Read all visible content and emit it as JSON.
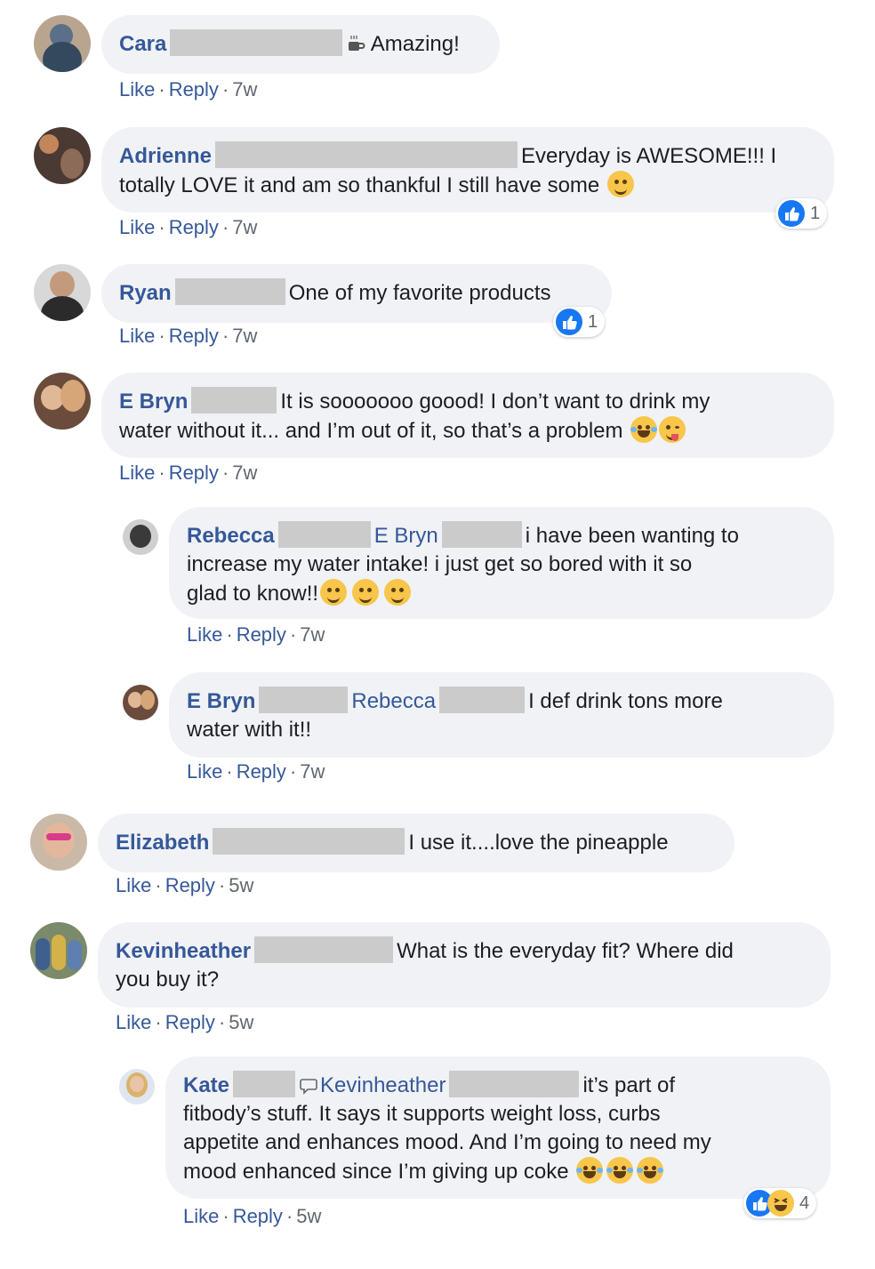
{
  "meta_labels": {
    "like": "Like",
    "reply": "Reply",
    "sep": "·"
  },
  "comments": [
    {
      "name": "Cara",
      "text": "Amazing!",
      "time": "7w"
    },
    {
      "name": "Adrienne",
      "text_line1": "Everyday is AWESOME!!! I",
      "text_line2": "totally LOVE it and am so thankful I still have some",
      "time": "7w",
      "reactions": "1"
    },
    {
      "name": "Ryan",
      "text": "One of my favorite products",
      "time": "7w",
      "reactions": "1"
    },
    {
      "name": "E Bryn",
      "text_line1": "It is sooooooo goood! I don’t want to drink my",
      "text_line2": "water without it... and I’m out of it, so that’s a problem",
      "time": "7w"
    },
    {
      "name": "Rebecca",
      "tag": "E Bryn",
      "text_line1": "i have been wanting to",
      "text_line2": "increase my water intake! i just get so bored with it so",
      "text_line3": "glad to know!!",
      "time": "7w"
    },
    {
      "name": "E Bryn",
      "tag": "Rebecca",
      "text_line1": "I def drink tons more",
      "text_line2": "water with it!!",
      "time": "7w"
    },
    {
      "name": "Elizabeth",
      "text": "I use it....love the pineapple",
      "time": "5w"
    },
    {
      "name": "Kevinheather",
      "text_line1": "What is the everyday fit? Where did",
      "text_line2": "you buy it?",
      "time": "5w"
    },
    {
      "name": "Kate",
      "tag": "Kevinheather",
      "text_line1": "it’s part of",
      "text_line2": "fitbody’s stuff. It says it supports weight loss, curbs",
      "text_line3": "appetite and enhances mood. And I’m going to need my",
      "text_line4": "mood enhanced since I’m giving up coke",
      "time": "5w",
      "reactions": "4"
    }
  ]
}
